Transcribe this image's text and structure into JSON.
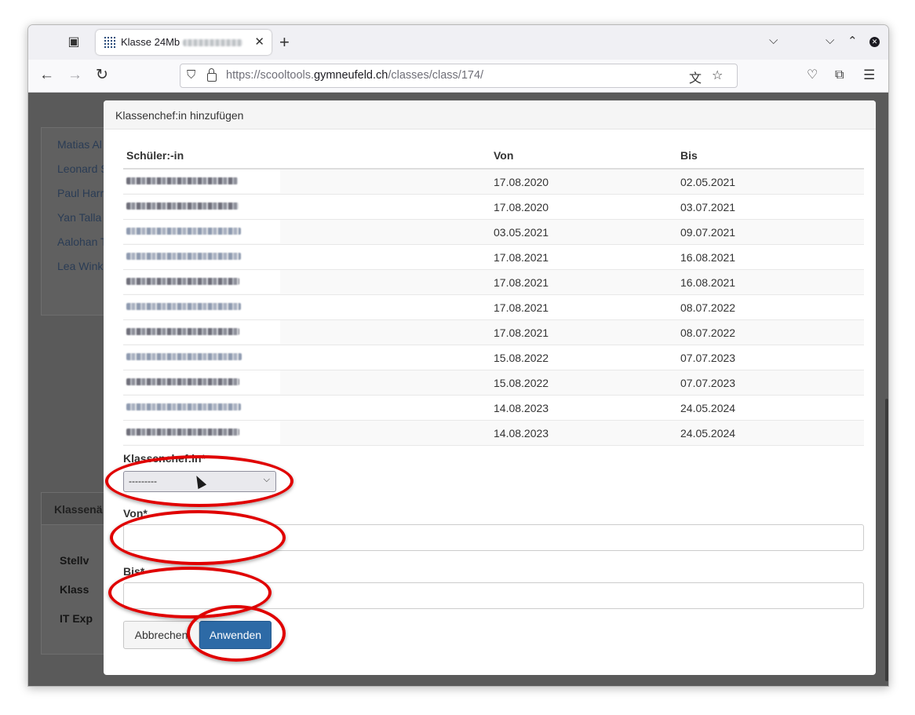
{
  "browser": {
    "tab_title": "Klasse 24Mb",
    "url_prefix": "https://scooltools.",
    "url_domain": "gymneufeld.ch",
    "url_path": "/classes/class/174/"
  },
  "background": {
    "names": [
      "Matias Al",
      "Leonard S",
      "Paul Harr",
      "Yan Talla",
      "Aalohan T",
      "Lea Wink"
    ],
    "panel_header": "Klassenä",
    "links": [
      "Stellv",
      "Klass",
      "IT Exp"
    ]
  },
  "modal": {
    "title": "Klassenchef:in hinzufügen",
    "headers": [
      "Schüler:-in",
      "Von",
      "Bis"
    ],
    "rows": [
      {
        "von": "17.08.2020",
        "bis": "02.05.2021"
      },
      {
        "von": "17.08.2020",
        "bis": "03.07.2021"
      },
      {
        "von": "03.05.2021",
        "bis": "09.07.2021"
      },
      {
        "von": "17.08.2021",
        "bis": "16.08.2021"
      },
      {
        "von": "17.08.2021",
        "bis": "16.08.2021"
      },
      {
        "von": "17.08.2021",
        "bis": "08.07.2022"
      },
      {
        "von": "17.08.2021",
        "bis": "08.07.2022"
      },
      {
        "von": "15.08.2022",
        "bis": "07.07.2023"
      },
      {
        "von": "15.08.2022",
        "bis": "07.07.2023"
      },
      {
        "von": "14.08.2023",
        "bis": "24.05.2024"
      },
      {
        "von": "14.08.2023",
        "bis": "24.05.2024"
      }
    ],
    "form": {
      "klassenchef_label": "Klassenchef:in*",
      "select_value": "---------",
      "von_label": "Von*",
      "bis_label": "Bis*",
      "cancel_label": "Abbrechen",
      "apply_label": "Anwenden"
    }
  },
  "colors": {
    "annotation_ring": "#e00000",
    "primary_button": "#2d6aa6"
  }
}
